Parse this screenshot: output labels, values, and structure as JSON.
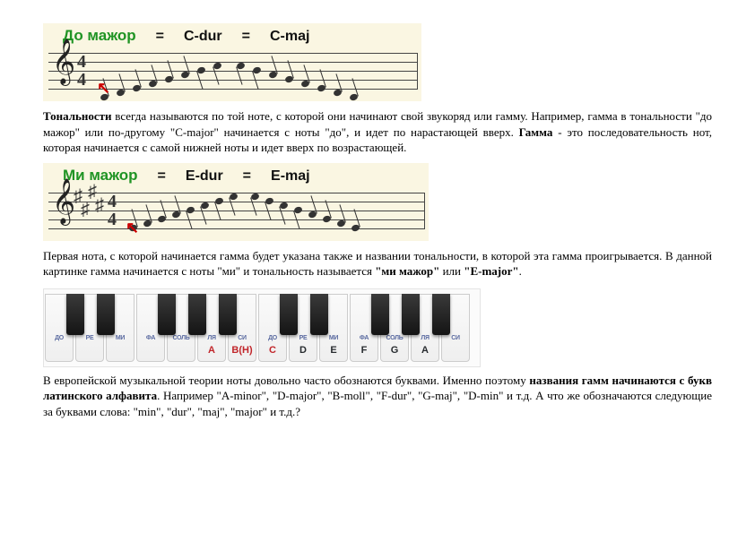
{
  "score1": {
    "key_name": "До мажор",
    "dur": "C-dur",
    "maj": "C-maj",
    "eq": "="
  },
  "para1": {
    "t1": "Тональности",
    "t2": " всегда называются по той ноте, с которой они начинают свой звукоряд или гамму. Например, гамма в тональности \"до мажор\" или по-другому \"C-major\" начинается с ноты \"до\", и идет по нарастающей вверх. ",
    "t3": "Гамма",
    "t4": " - это последовательность нот, которая начинается с самой нижней ноты и идет вверх по возрастающей."
  },
  "score2": {
    "key_name": "Ми мажор",
    "dur": "E-dur",
    "maj": "E-maj",
    "eq": "="
  },
  "para2": {
    "t1": "Первая нота, с которой начинается гамма будет указана также и названии тональности, в которой эта гамма проигрывается. В данной картинке гамма начинается с ноты \"ми\" и тональность называется ",
    "t2": "\"ми мажор\"",
    "t3": " или ",
    "t4": "\"E-major\"",
    "t5": "."
  },
  "kbd": [
    {
      "ru": "ДО",
      "letter": "",
      "style": "dark"
    },
    {
      "ru": "РЕ",
      "letter": "",
      "style": "dark"
    },
    {
      "ru": "МИ",
      "letter": "",
      "style": "dark"
    },
    {
      "ru": "ФА",
      "letter": "",
      "style": "dark"
    },
    {
      "ru": "СОЛЬ",
      "letter": "",
      "style": "dark"
    },
    {
      "ru": "ЛЯ",
      "letter": "A",
      "style": "red"
    },
    {
      "ru": "СИ",
      "letter": "B(H)",
      "style": "red"
    },
    {
      "ru": "ДО",
      "letter": "C",
      "style": "red"
    },
    {
      "ru": "РЕ",
      "letter": "D",
      "style": "dark"
    },
    {
      "ru": "МИ",
      "letter": "E",
      "style": "dark"
    },
    {
      "ru": "ФА",
      "letter": "F",
      "style": "dark"
    },
    {
      "ru": "СОЛЬ",
      "letter": "G",
      "style": "dark"
    },
    {
      "ru": "ЛЯ",
      "letter": "A",
      "style": "dark"
    },
    {
      "ru": "СИ",
      "letter": "",
      "style": "dark"
    }
  ],
  "para3": {
    "t1": "В европейской музыкальной теории ноты довольно часто обознаются буквами. Именно поэтому ",
    "t2": "названия гамм начинаются с букв латинского алфавита",
    "t3": ". Например \"A-minor\", \"D-major\", \"B-moll\", \"F-dur\", \"G-maj\", \"D-min\" и т.д. А что же обозначаются следующие за буквами слова: \"min\", \"dur\", \"maj\", \"major\"  и т.д.?"
  },
  "chart_data": {
    "type": "table",
    "description": "White piano keys with Russian solfège labels and Latin note letters",
    "rows": [
      {
        "ru": "ДО",
        "letter": ""
      },
      {
        "ru": "РЕ",
        "letter": ""
      },
      {
        "ru": "МИ",
        "letter": ""
      },
      {
        "ru": "ФА",
        "letter": ""
      },
      {
        "ru": "СОЛЬ",
        "letter": ""
      },
      {
        "ru": "ЛЯ",
        "letter": "A"
      },
      {
        "ru": "СИ",
        "letter": "B(H)"
      },
      {
        "ru": "ДО",
        "letter": "C"
      },
      {
        "ru": "РЕ",
        "letter": "D"
      },
      {
        "ru": "МИ",
        "letter": "E"
      },
      {
        "ru": "ФА",
        "letter": "F"
      },
      {
        "ru": "СОЛЬ",
        "letter": "G"
      },
      {
        "ru": "ЛЯ",
        "letter": "A"
      },
      {
        "ru": "СИ",
        "letter": ""
      }
    ]
  }
}
